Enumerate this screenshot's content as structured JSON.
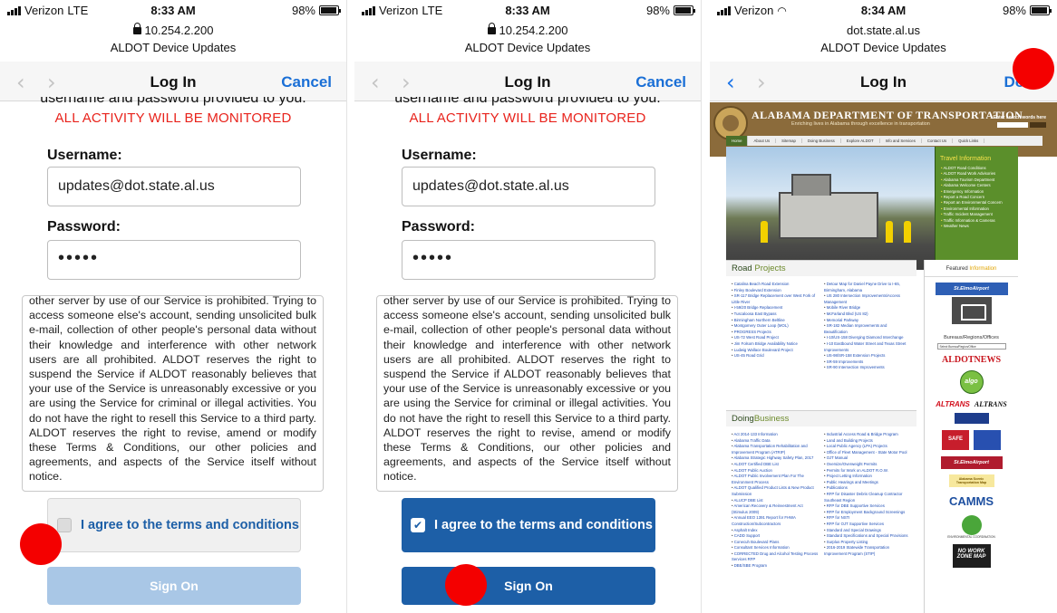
{
  "common": {
    "carrier": "Verizon",
    "network": "LTE",
    "battery": "98%",
    "site_name": "ALDOT Device Updates",
    "nav_title": "Log In",
    "cut_text": "username and password provided to you.",
    "monitor_warning": "ALL ACTIVITY WILL BE MONITORED",
    "username_label": "Username:",
    "username_value": "updates@dot.state.al.us",
    "password_label": "Password:",
    "password_value": "•••••",
    "terms_text": "other server by use of our Service is prohibited. Trying to access someone else's account, sending unsolicited bulk e-mail, collection of other people's personal data without their knowledge and interference with other network users are all prohibited. ALDOT reserves the right to suspend the Service if ALDOT reasonably believes that your use of the Service is unreasonably excessive or you are using the Service for criminal or illegal activities. You do not have the right to resell this Service to a third party. ALDOT reserves the right to revise, amend or modify these Terms & Conditions, our other policies and agreements, and aspects of the Service itself without notice.",
    "agree_label": "I agree to the terms and conditions",
    "signon_label": "Sign On"
  },
  "screens": [
    {
      "time": "8:33 AM",
      "url": "10.254.2.200",
      "nav_action": "Cancel",
      "agree_checked": false,
      "signon_enabled": false
    },
    {
      "time": "8:33 AM",
      "url": "10.254.2.200",
      "nav_action": "Cancel",
      "agree_checked": true,
      "signon_enabled": true
    },
    {
      "time": "8:34 AM",
      "url": "dot.state.al.us",
      "nav_action": "Done"
    }
  ],
  "icons": {
    "back": "chevron-left-icon",
    "forward": "chevron-right-icon",
    "lock": "lock-icon",
    "wifi": "wifi-icon",
    "battery": "battery-icon",
    "check": "checkmark-icon"
  },
  "colors": {
    "accent": "#1a6fd6",
    "warning": "#e8231c",
    "button_active": "#1d5fa7",
    "button_disabled": "#a9c7e6",
    "tap_marker": "#f40000"
  },
  "website": {
    "title": "ALABAMA DEPARTMENT OF TRANSPORTATION",
    "tagline": "Enriching lives in Alabama through excellence in transportation",
    "search_label": "Enter search words here",
    "menu": [
      "Home",
      "About Us",
      "Sitemap",
      "Doing Business",
      "Explore ALDOT",
      "Info and Services",
      "Contact Us",
      "Quick Links"
    ],
    "travel_heading": "Travel Information",
    "travel_items": [
      "ALDOT Road Conditions",
      "ALDOT Road Work Advisories",
      "Alabama Tourism Department",
      "Alabama Welcome Centers",
      "Emergency Information",
      "Report a Road Concern",
      "Report an Environmental Concern",
      "Environmental Information",
      "Traffic Incident Management",
      "Traffic Information & Cameras",
      "Weather News"
    ],
    "road_projects_heading": [
      "Road ",
      "Projects"
    ],
    "road_projects_left": [
      "Catalina Beach Road Extension",
      "Finley Boulevard Extension",
      "SR-117 Bridge Replacement over West Fork of Little River",
      "I-59/20 Bridge Replacement",
      "Tuscaloosa East Bypass",
      "Birmingham Northern Beltline",
      "Montgomery Outer Loop (MOL)",
      "PROGRESS Projects",
      "US-72 West Road Project",
      "Jim Folsom Bridge Availability Notice",
      "Ludwig Wallace Boulevard Project",
      "US-45 Road Grid"
    ],
    "road_projects_right": [
      "Detour Map for Daniel Payne Drive to I-65, Birmingham, Alabama",
      "US 280 Intersection Improvements/Access Management",
      "Mobile River Bridge",
      "McFarland Blvd (US 82)",
      "Memorial Parkway",
      "SR-182 Median Improvements and Beautification",
      "I-10/US-158 Diverging Diamond Interchange",
      "I-10 Eastbound Water Street and Texas Street Improvements",
      "US-98/SR-158 Extension Projects",
      "SR-59 Improvements",
      "SR-90 Intersection Improvements"
    ],
    "doing_business_heading": [
      "Doing",
      "Business"
    ],
    "doing_business_left": [
      "Act 2014-133 Information",
      "Alabama Traffic Data",
      "Alabama Transportation Rehabilitation and Improvement Program (ATRIP)",
      "Alabama Strategic Highway Safety Plan, 2017",
      "ALDOT Certified DBE List",
      "ALDOT Public Auction",
      "ALDOT Public Involvement Plan For The Environment Process",
      "ALDOT Qualified Product Lists & New Product Submission",
      "ALUCP DBE List",
      "American Recovery & Reinvestment Act (Stimulus 2009)",
      "Annual EEO 1391 Report for FHWA Construction/Subcontractors",
      "Asphalt Index",
      "CADD Support",
      "Conecuh Boulevard Plans",
      "Consultant Services Information",
      "CORRECTED Drug and Alcohol Testing Process Services RFP",
      "DBE/SBE Program"
    ],
    "doing_business_right": [
      "Industrial Access Road & Bridge Program",
      "Land and Building Projects",
      "Local Public Agency (LPA) Projects",
      "Office of Fleet Management - State Motor Pool",
      "OJT Manual",
      "Oversize/Overweight Permits",
      "Permits for Work on ALDOT R.O.W.",
      "Project Letting Information",
      "Public Hearings and Meetings",
      "Publications",
      "RFP for Disaster Debris Cleanup Contractor Southeast Region",
      "RFP for DBE Supportive Services",
      "RFP for Employment Background Screenings",
      "RFP for NSTI",
      "RFP for OJT Supportive Services",
      "Standard and Special Drawings",
      "Standard Specifications and Special Provisions",
      "Surplus Property Listing",
      "2016-2019 Statewide Transportation Improvement Program (STIP)"
    ],
    "featured_heading": [
      "Featured ",
      "Information"
    ],
    "airport_logo": "St.ElmoAirport",
    "bureaus_label": "Bureaus/Regions/Offices",
    "bureau_select": "Select Bureau/Region/Office",
    "news_logo": "ALDOTNEWS",
    "algo_logo": "algo",
    "altrans_logo": "ALTRANS",
    "safe_logo": "SAFE",
    "airport_logo_2": "St.ElmoAirport",
    "scenic_logo": "Alabama Scenic Transportation Map",
    "camms_logo": "CAMMS",
    "env_caption": "ENVIRONMENTAL COORDINATION",
    "work_zone_logo": "NO WORK ZONE MAP"
  }
}
